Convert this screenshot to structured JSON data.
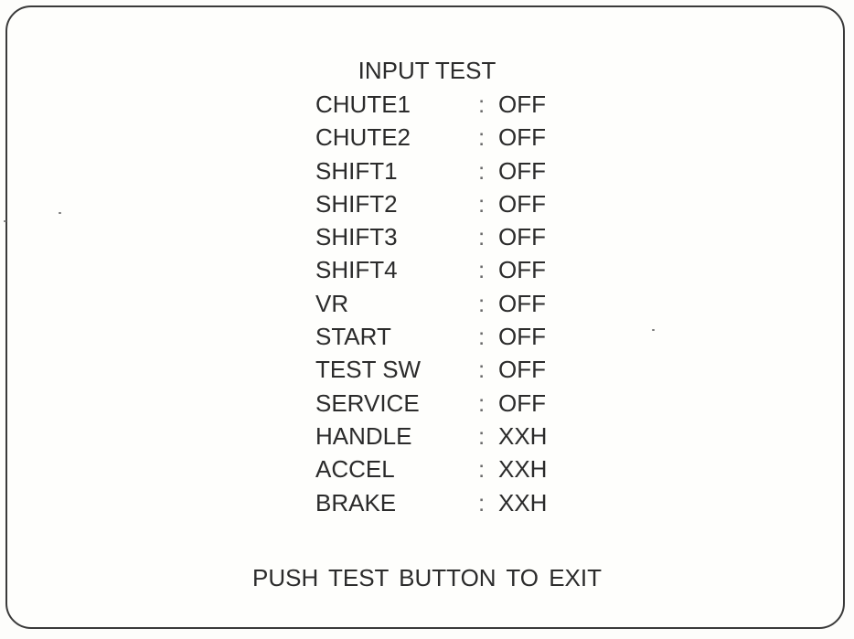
{
  "screen": {
    "title": "INPUT TEST",
    "footer": "PUSH TEST BUTTON TO EXIT",
    "rows": [
      {
        "label": "CHUTE1",
        "sep": ":",
        "value": "OFF"
      },
      {
        "label": "CHUTE2",
        "sep": ":",
        "value": "OFF"
      },
      {
        "label": "SHIFT1",
        "sep": ":",
        "value": "OFF"
      },
      {
        "label": "SHIFT2",
        "sep": ":",
        "value": "OFF"
      },
      {
        "label": "SHIFT3",
        "sep": ":",
        "value": "OFF"
      },
      {
        "label": "SHIFT4",
        "sep": ":",
        "value": "OFF"
      },
      {
        "label": "VR",
        "sep": ":",
        "value": "OFF"
      },
      {
        "label": "START",
        "sep": ":",
        "value": "OFF"
      },
      {
        "label": "TEST SW",
        "sep": ":",
        "value": "OFF"
      },
      {
        "label": "SERVICE",
        "sep": ":",
        "value": "OFF"
      },
      {
        "label": "HANDLE",
        "sep": ":",
        "value": "XXH"
      },
      {
        "label": "ACCEL",
        "sep": ":",
        "value": "XXH"
      },
      {
        "label": "BRAKE",
        "sep": ":",
        "value": "XXH"
      }
    ]
  },
  "colors": {
    "text": "#2b2b2b",
    "frame": "#3a3a3a",
    "background": "#fefefc"
  }
}
